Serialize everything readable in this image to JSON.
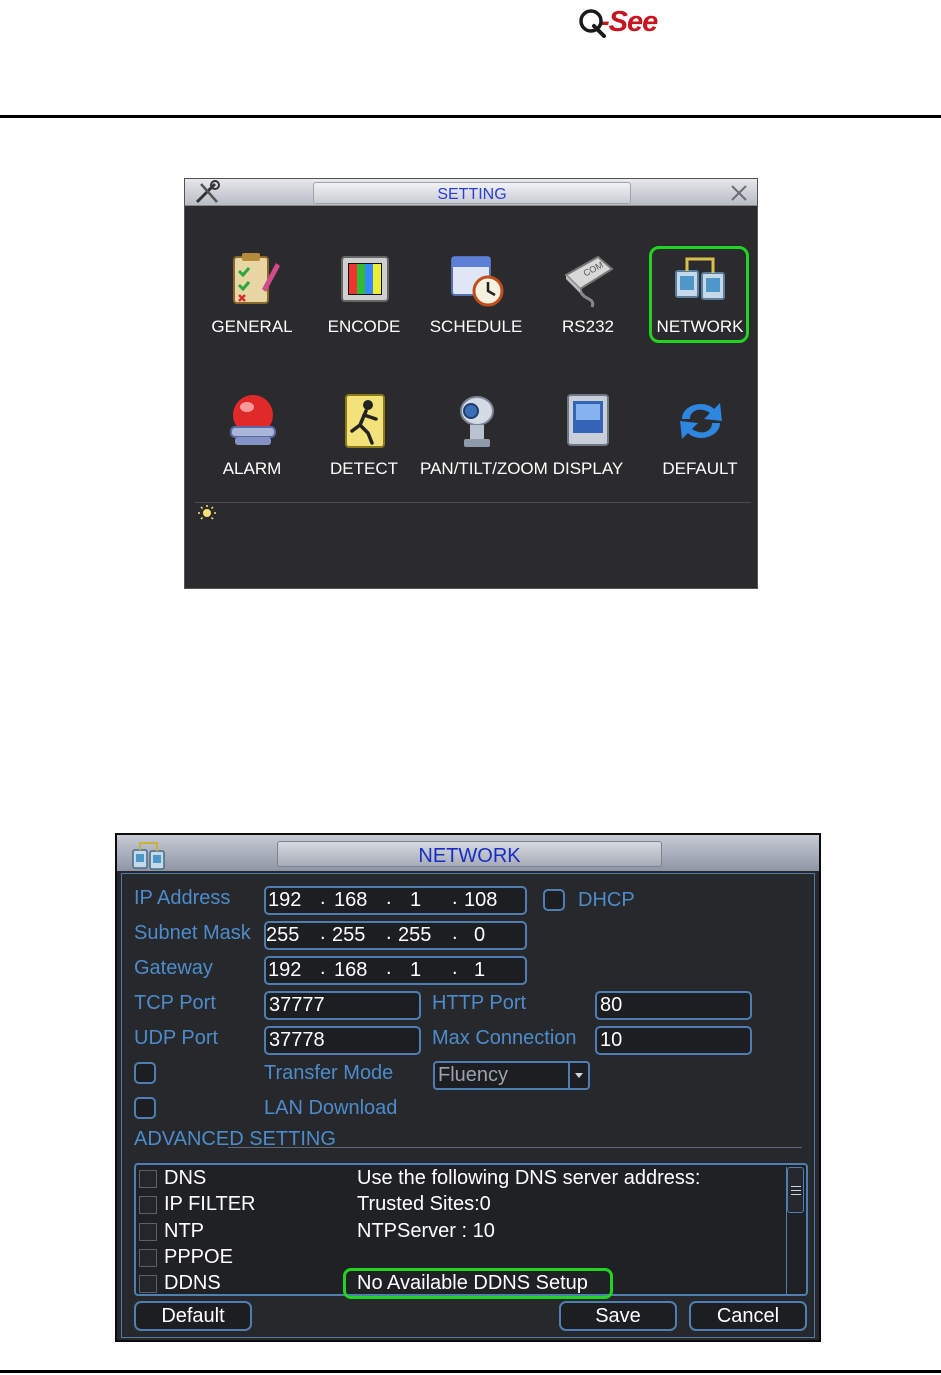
{
  "brand": {
    "logo_text": "-See"
  },
  "setting_window": {
    "title": "SETTING",
    "items": [
      {
        "label": "GENERAL"
      },
      {
        "label": "ENCODE"
      },
      {
        "label": "SCHEDULE"
      },
      {
        "label": "RS232"
      },
      {
        "label": "NETWORK"
      },
      {
        "label": "ALARM"
      },
      {
        "label": "DETECT"
      },
      {
        "label": "PAN/TILT/ZOOM"
      },
      {
        "label": "DISPLAY"
      },
      {
        "label": "DEFAULT"
      }
    ],
    "highlight_color": "#22d422"
  },
  "network_window": {
    "title": "NETWORK",
    "ip_address": {
      "label": "IP Address",
      "octets": [
        "192",
        "168",
        "1",
        "108"
      ]
    },
    "subnet_mask": {
      "label": "Subnet Mask",
      "octets": [
        "255",
        "255",
        "255",
        "0"
      ]
    },
    "gateway": {
      "label": "Gateway",
      "octets": [
        "192",
        "168",
        "1",
        "1"
      ]
    },
    "dhcp": {
      "label": "DHCP",
      "checked": false
    },
    "tcp_port": {
      "label": "TCP Port",
      "value": "37777"
    },
    "http_port": {
      "label": "HTTP Port",
      "value": "80"
    },
    "udp_port": {
      "label": "UDP Port",
      "value": "37778"
    },
    "max_connection": {
      "label": "Max Connection",
      "value": "10"
    },
    "transfer_mode": {
      "label": "Transfer Mode",
      "value": "Fluency",
      "checked": false
    },
    "lan_download": {
      "label": "LAN Download",
      "checked": false
    },
    "advanced_heading": "ADVANCED SETTING",
    "advanced": [
      {
        "name": "DNS",
        "desc": "Use the following DNS server address:"
      },
      {
        "name": "IP FILTER",
        "desc": "Trusted Sites:0"
      },
      {
        "name": "NTP",
        "desc": "NTPServer : 10"
      },
      {
        "name": "PPPOE",
        "desc": ""
      },
      {
        "name": "DDNS",
        "desc": "No  Available DDNS Setup"
      }
    ],
    "buttons": {
      "default": "Default",
      "save": "Save",
      "cancel": "Cancel"
    },
    "label_color": "#4d8ccb",
    "highlight_color": "#22d422"
  }
}
